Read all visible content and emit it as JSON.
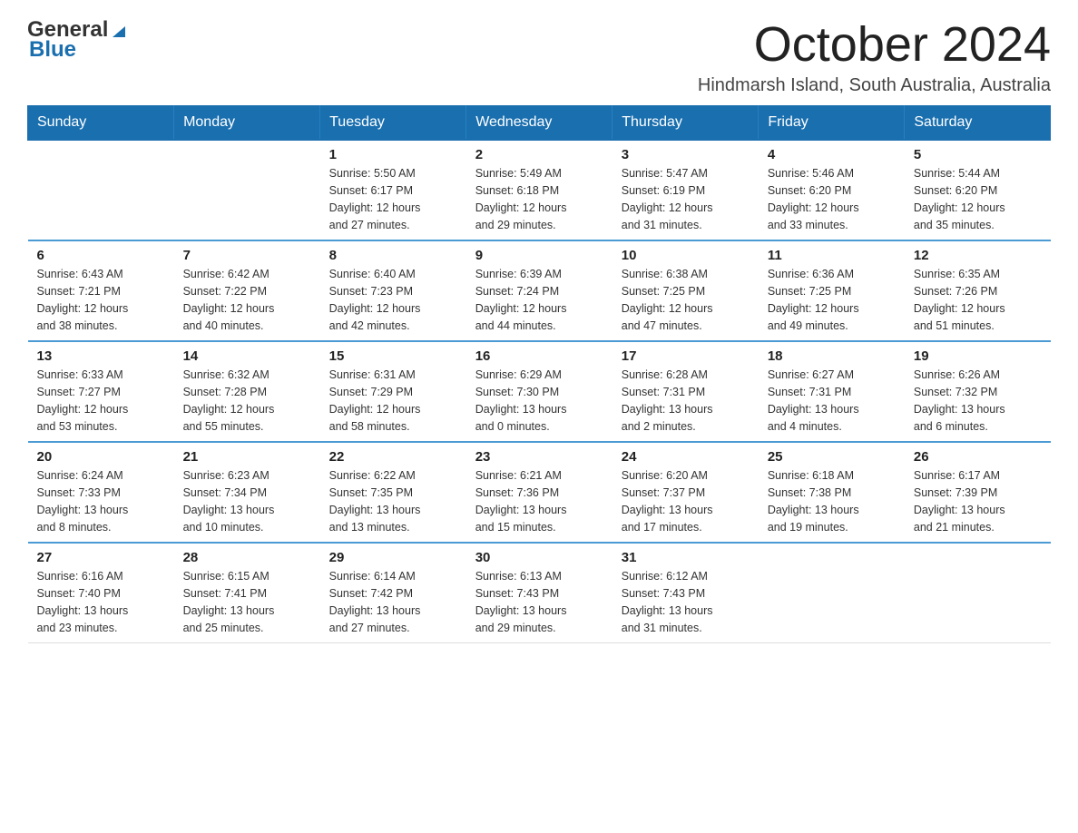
{
  "header": {
    "logo_general": "General",
    "logo_blue": "Blue",
    "month_title": "October 2024",
    "location": "Hindmarsh Island, South Australia, Australia"
  },
  "calendar": {
    "days_of_week": [
      "Sunday",
      "Monday",
      "Tuesday",
      "Wednesday",
      "Thursday",
      "Friday",
      "Saturday"
    ],
    "weeks": [
      [
        {
          "day": "",
          "info": ""
        },
        {
          "day": "",
          "info": ""
        },
        {
          "day": "1",
          "info": "Sunrise: 5:50 AM\nSunset: 6:17 PM\nDaylight: 12 hours\nand 27 minutes."
        },
        {
          "day": "2",
          "info": "Sunrise: 5:49 AM\nSunset: 6:18 PM\nDaylight: 12 hours\nand 29 minutes."
        },
        {
          "day": "3",
          "info": "Sunrise: 5:47 AM\nSunset: 6:19 PM\nDaylight: 12 hours\nand 31 minutes."
        },
        {
          "day": "4",
          "info": "Sunrise: 5:46 AM\nSunset: 6:20 PM\nDaylight: 12 hours\nand 33 minutes."
        },
        {
          "day": "5",
          "info": "Sunrise: 5:44 AM\nSunset: 6:20 PM\nDaylight: 12 hours\nand 35 minutes."
        }
      ],
      [
        {
          "day": "6",
          "info": "Sunrise: 6:43 AM\nSunset: 7:21 PM\nDaylight: 12 hours\nand 38 minutes."
        },
        {
          "day": "7",
          "info": "Sunrise: 6:42 AM\nSunset: 7:22 PM\nDaylight: 12 hours\nand 40 minutes."
        },
        {
          "day": "8",
          "info": "Sunrise: 6:40 AM\nSunset: 7:23 PM\nDaylight: 12 hours\nand 42 minutes."
        },
        {
          "day": "9",
          "info": "Sunrise: 6:39 AM\nSunset: 7:24 PM\nDaylight: 12 hours\nand 44 minutes."
        },
        {
          "day": "10",
          "info": "Sunrise: 6:38 AM\nSunset: 7:25 PM\nDaylight: 12 hours\nand 47 minutes."
        },
        {
          "day": "11",
          "info": "Sunrise: 6:36 AM\nSunset: 7:25 PM\nDaylight: 12 hours\nand 49 minutes."
        },
        {
          "day": "12",
          "info": "Sunrise: 6:35 AM\nSunset: 7:26 PM\nDaylight: 12 hours\nand 51 minutes."
        }
      ],
      [
        {
          "day": "13",
          "info": "Sunrise: 6:33 AM\nSunset: 7:27 PM\nDaylight: 12 hours\nand 53 minutes."
        },
        {
          "day": "14",
          "info": "Sunrise: 6:32 AM\nSunset: 7:28 PM\nDaylight: 12 hours\nand 55 minutes."
        },
        {
          "day": "15",
          "info": "Sunrise: 6:31 AM\nSunset: 7:29 PM\nDaylight: 12 hours\nand 58 minutes."
        },
        {
          "day": "16",
          "info": "Sunrise: 6:29 AM\nSunset: 7:30 PM\nDaylight: 13 hours\nand 0 minutes."
        },
        {
          "day": "17",
          "info": "Sunrise: 6:28 AM\nSunset: 7:31 PM\nDaylight: 13 hours\nand 2 minutes."
        },
        {
          "day": "18",
          "info": "Sunrise: 6:27 AM\nSunset: 7:31 PM\nDaylight: 13 hours\nand 4 minutes."
        },
        {
          "day": "19",
          "info": "Sunrise: 6:26 AM\nSunset: 7:32 PM\nDaylight: 13 hours\nand 6 minutes."
        }
      ],
      [
        {
          "day": "20",
          "info": "Sunrise: 6:24 AM\nSunset: 7:33 PM\nDaylight: 13 hours\nand 8 minutes."
        },
        {
          "day": "21",
          "info": "Sunrise: 6:23 AM\nSunset: 7:34 PM\nDaylight: 13 hours\nand 10 minutes."
        },
        {
          "day": "22",
          "info": "Sunrise: 6:22 AM\nSunset: 7:35 PM\nDaylight: 13 hours\nand 13 minutes."
        },
        {
          "day": "23",
          "info": "Sunrise: 6:21 AM\nSunset: 7:36 PM\nDaylight: 13 hours\nand 15 minutes."
        },
        {
          "day": "24",
          "info": "Sunrise: 6:20 AM\nSunset: 7:37 PM\nDaylight: 13 hours\nand 17 minutes."
        },
        {
          "day": "25",
          "info": "Sunrise: 6:18 AM\nSunset: 7:38 PM\nDaylight: 13 hours\nand 19 minutes."
        },
        {
          "day": "26",
          "info": "Sunrise: 6:17 AM\nSunset: 7:39 PM\nDaylight: 13 hours\nand 21 minutes."
        }
      ],
      [
        {
          "day": "27",
          "info": "Sunrise: 6:16 AM\nSunset: 7:40 PM\nDaylight: 13 hours\nand 23 minutes."
        },
        {
          "day": "28",
          "info": "Sunrise: 6:15 AM\nSunset: 7:41 PM\nDaylight: 13 hours\nand 25 minutes."
        },
        {
          "day": "29",
          "info": "Sunrise: 6:14 AM\nSunset: 7:42 PM\nDaylight: 13 hours\nand 27 minutes."
        },
        {
          "day": "30",
          "info": "Sunrise: 6:13 AM\nSunset: 7:43 PM\nDaylight: 13 hours\nand 29 minutes."
        },
        {
          "day": "31",
          "info": "Sunrise: 6:12 AM\nSunset: 7:43 PM\nDaylight: 13 hours\nand 31 minutes."
        },
        {
          "day": "",
          "info": ""
        },
        {
          "day": "",
          "info": ""
        }
      ]
    ]
  }
}
